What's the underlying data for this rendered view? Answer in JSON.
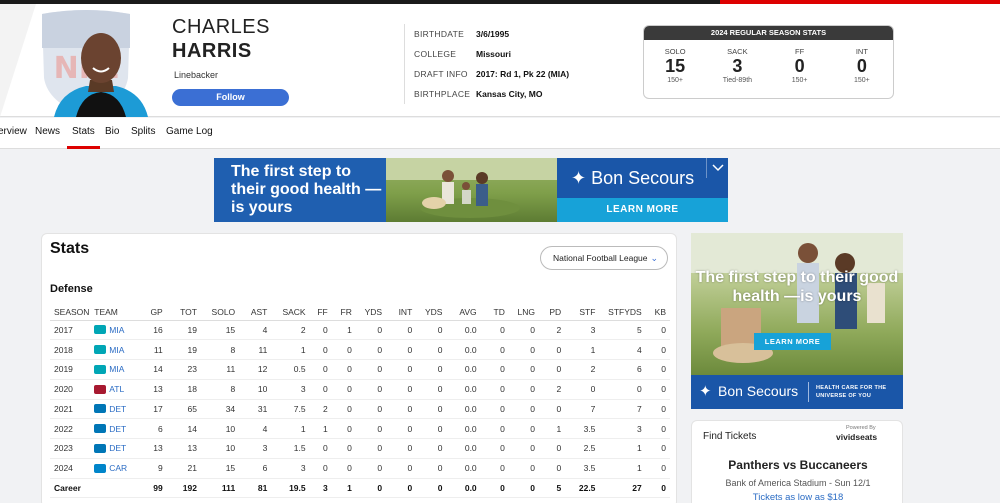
{
  "player": {
    "first_name": "CHARLES",
    "last_name": "HARRIS",
    "position": "Linebacker",
    "follow_label": "Follow"
  },
  "bio": [
    {
      "label": "BIRTHDATE",
      "value": "3/6/1995"
    },
    {
      "label": "COLLEGE",
      "value": "Missouri"
    },
    {
      "label": "DRAFT INFO",
      "value": "2017: Rd 1, Pk 22 (MIA)"
    },
    {
      "label": "BIRTHPLACE",
      "value": "Kansas City, MO"
    }
  ],
  "season_stats": {
    "title": "2024 REGULAR SEASON STATS",
    "items": [
      {
        "label": "SOLO",
        "value": "15",
        "rank": "150+"
      },
      {
        "label": "SACK",
        "value": "3",
        "rank": "Tied-89th"
      },
      {
        "label": "FF",
        "value": "0",
        "rank": "150+"
      },
      {
        "label": "INT",
        "value": "0",
        "rank": "150+"
      }
    ]
  },
  "nav": {
    "items": [
      "erview",
      "News",
      "Stats",
      "Bio",
      "Splits",
      "Game Log"
    ],
    "active": "Stats"
  },
  "ad_top": {
    "headline": "The first step to their good health —is yours",
    "brand": "Bon Secours",
    "cta": "LEARN MORE"
  },
  "stats_card": {
    "title": "Stats",
    "league_select": "National Football League",
    "section_title": "Defense",
    "columns": [
      "SEASON",
      "TEAM",
      "GP",
      "TOT",
      "SOLO",
      "AST",
      "SACK",
      "FF",
      "FR",
      "YDS",
      "INT",
      "YDS",
      "AVG",
      "TD",
      "LNG",
      "PD",
      "STF",
      "STFYDS",
      "KB"
    ],
    "rows": [
      {
        "season": "2017",
        "team": "MIA",
        "team_color": "#00a6b5",
        "stats": [
          "16",
          "19",
          "15",
          "4",
          "2",
          "0",
          "1",
          "0",
          "0",
          "0",
          "0.0",
          "0",
          "0",
          "2",
          "3",
          "5",
          "0"
        ]
      },
      {
        "season": "2018",
        "team": "MIA",
        "team_color": "#00a6b5",
        "stats": [
          "11",
          "19",
          "8",
          "11",
          "1",
          "0",
          "0",
          "0",
          "0",
          "0",
          "0.0",
          "0",
          "0",
          "0",
          "1",
          "4",
          "0"
        ]
      },
      {
        "season": "2019",
        "team": "MIA",
        "team_color": "#00a6b5",
        "stats": [
          "14",
          "23",
          "11",
          "12",
          "0.5",
          "0",
          "0",
          "0",
          "0",
          "0",
          "0.0",
          "0",
          "0",
          "0",
          "2",
          "6",
          "0"
        ]
      },
      {
        "season": "2020",
        "team": "ATL",
        "team_color": "#a71930",
        "stats": [
          "13",
          "18",
          "8",
          "10",
          "3",
          "0",
          "0",
          "0",
          "0",
          "0",
          "0.0",
          "0",
          "0",
          "2",
          "0",
          "0",
          "0"
        ]
      },
      {
        "season": "2021",
        "team": "DET",
        "team_color": "#0076b6",
        "stats": [
          "17",
          "65",
          "34",
          "31",
          "7.5",
          "2",
          "0",
          "0",
          "0",
          "0",
          "0.0",
          "0",
          "0",
          "0",
          "7",
          "7",
          "0"
        ]
      },
      {
        "season": "2022",
        "team": "DET",
        "team_color": "#0076b6",
        "stats": [
          "6",
          "14",
          "10",
          "4",
          "1",
          "1",
          "0",
          "0",
          "0",
          "0",
          "0.0",
          "0",
          "0",
          "1",
          "3.5",
          "3",
          "0"
        ]
      },
      {
        "season": "2023",
        "team": "DET",
        "team_color": "#0076b6",
        "stats": [
          "13",
          "13",
          "10",
          "3",
          "1.5",
          "0",
          "0",
          "0",
          "0",
          "0",
          "0.0",
          "0",
          "0",
          "0",
          "2.5",
          "1",
          "0"
        ]
      },
      {
        "season": "2024",
        "team": "CAR",
        "team_color": "#0085ca",
        "stats": [
          "9",
          "21",
          "15",
          "6",
          "3",
          "0",
          "0",
          "0",
          "0",
          "0",
          "0.0",
          "0",
          "0",
          "0",
          "3.5",
          "1",
          "0"
        ]
      }
    ],
    "career": {
      "label": "Career",
      "stats": [
        "99",
        "192",
        "111",
        "81",
        "19.5",
        "3",
        "1",
        "0",
        "0",
        "0",
        "0.0",
        "0",
        "0",
        "5",
        "22.5",
        "27",
        "0"
      ]
    }
  },
  "ad_side": {
    "headline": "The first step to their good health —is yours",
    "cta": "LEARN MORE",
    "brand": "Bon Secours",
    "tagline": "HEALTH CARE FOR THE UNIVERSE OF YOU"
  },
  "tickets": {
    "title": "Find Tickets",
    "powered_by": "Powered By",
    "vendor": "vividseats",
    "matchup": "Panthers vs Buccaneers",
    "venue": "Bank of America Stadium - Sun 12/1",
    "price": "Tickets as low as $18"
  }
}
